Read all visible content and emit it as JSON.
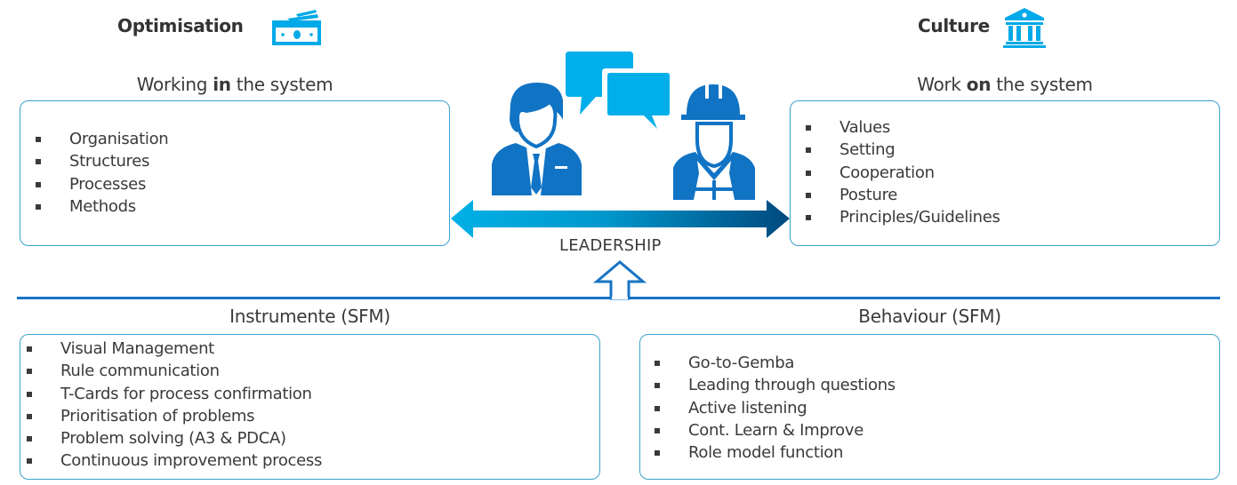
{
  "colors": {
    "accent_light": "#00a9e8",
    "accent_dark": "#1173c4",
    "arrow_gradient_start": "#00b0e6",
    "arrow_gradient_end": "#00497e",
    "box_border": "#3aa3cc",
    "divider": "#1a74c4",
    "text": "#3a3a3a"
  },
  "top_left": {
    "heading": "Optimisation",
    "icon": "money-bills-icon",
    "subtitle_pre": "Working ",
    "subtitle_bold": "in",
    "subtitle_post": " the system",
    "items": [
      "Organisation",
      "Structures",
      "Processes",
      "Methods"
    ]
  },
  "top_right": {
    "heading": "Culture",
    "icon": "institution-building-icon",
    "subtitle_pre": "Work ",
    "subtitle_bold": "on",
    "subtitle_post": " the system",
    "items": [
      "Values",
      "Setting",
      "Cooperation",
      "Posture",
      "Principles/Guidelines"
    ]
  },
  "center": {
    "icons": [
      "businessman-icon",
      "speech-bubbles-icon",
      "construction-worker-icon",
      "double-arrow-icon",
      "up-arrow-icon"
    ],
    "label": "LEADERSHIP"
  },
  "bottom_left": {
    "title": "Instrumente (SFM)",
    "items": [
      "Visual Management",
      "Rule communication",
      "T-Cards for process confirmation",
      "Prioritisation of problems",
      "Problem solving (A3 & PDCA)",
      "Continuous improvement process"
    ]
  },
  "bottom_right": {
    "title": "Behaviour (SFM)",
    "items": [
      "Go-to-Gemba",
      "Leading through questions",
      "Active listening",
      "Cont. Learn & Improve",
      "Role model function"
    ]
  }
}
